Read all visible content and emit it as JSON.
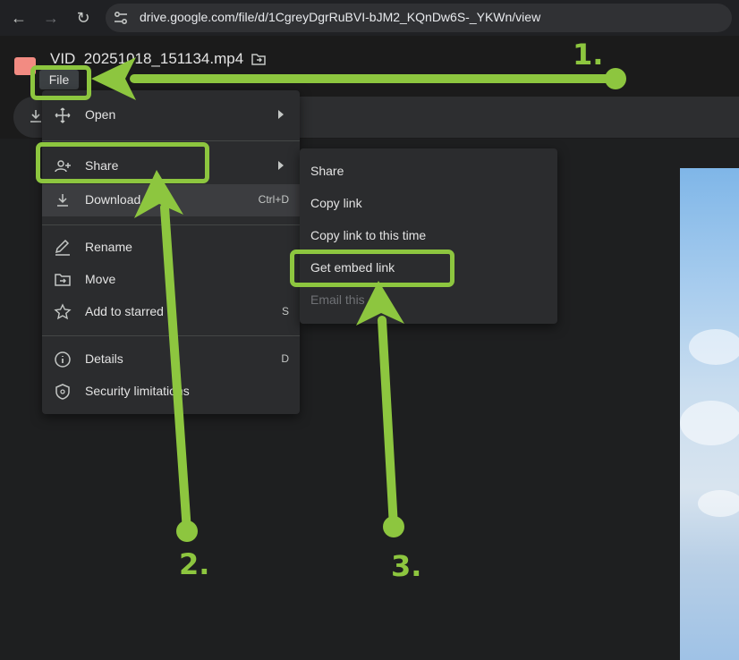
{
  "browser": {
    "back_icon": "arrow-left-icon",
    "forward_icon": "arrow-right-icon",
    "reload_icon": "reload-icon",
    "url": "drive.google.com/file/d/1CgreyDgrRuBVI-bJM2_KQnDw6S-_YKWn/view"
  },
  "header": {
    "title": "VID_20251018_151134.mp4",
    "file_menu_label": "File"
  },
  "main_menu": {
    "items": [
      {
        "label": "Open",
        "icon": "move-arrows-icon",
        "submenu": true
      },
      {
        "label": "Share",
        "icon": "person-add-icon",
        "submenu": true
      },
      {
        "label": "Download",
        "icon": "download-icon",
        "shortcut": "Ctrl+D"
      },
      {
        "label": "Rename",
        "icon": "pencil-icon"
      },
      {
        "label": "Move",
        "icon": "folder-move-icon"
      },
      {
        "label": "Add to starred",
        "icon": "star-icon",
        "shortcut": "S"
      },
      {
        "label": "Details",
        "icon": "info-icon",
        "shortcut": "D"
      },
      {
        "label": "Security limitations",
        "icon": "shield-icon"
      }
    ]
  },
  "share_menu": {
    "items": [
      {
        "label": "Share"
      },
      {
        "label": "Copy link"
      },
      {
        "label": "Copy link to this time"
      },
      {
        "label": "Get embed link"
      },
      {
        "label": "Email this"
      }
    ]
  },
  "annotations": {
    "step1": "1.",
    "step2": "2.",
    "step3": "3.",
    "color": "#8dc63f"
  }
}
